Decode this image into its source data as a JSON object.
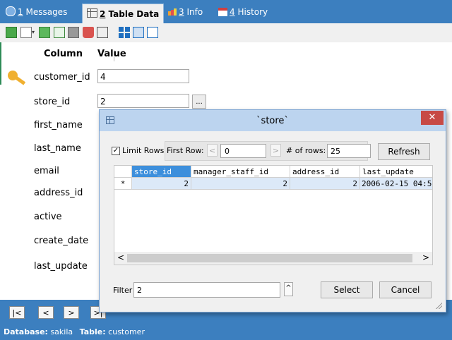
{
  "tabs": [
    {
      "num": "1",
      "label": "Messages"
    },
    {
      "num": "2",
      "label": "Table Data"
    },
    {
      "num": "3",
      "label": "Info"
    },
    {
      "num": "4",
      "label": "History"
    }
  ],
  "form": {
    "header_column": "Column",
    "header_value": "Value",
    "fields": [
      {
        "label": "customer_id",
        "value": "4"
      },
      {
        "label": "store_id",
        "value": "2"
      },
      {
        "label": "first_name"
      },
      {
        "label": "last_name"
      },
      {
        "label": "email"
      },
      {
        "label": "address_id"
      },
      {
        "label": "active"
      },
      {
        "label": "create_date"
      },
      {
        "label": "last_update"
      }
    ],
    "lookup_button": "..."
  },
  "nav": {
    "first": "|<",
    "prev": "<",
    "next": ">",
    "last": ">|"
  },
  "status": {
    "db_label": "Database:",
    "db_value": "sakila",
    "table_label": "Table:",
    "table_value": "customer"
  },
  "dialog": {
    "title": "`store`",
    "close": "✕",
    "limit_rows_label": "Limit Rows",
    "limit_checked": true,
    "first_row_label": "First Row:",
    "first_row_value": "0",
    "rows_label": "# of rows:",
    "rows_value": "25",
    "refresh": "Refresh",
    "grid": {
      "columns": [
        "store_id",
        "manager_staff_id",
        "address_id",
        "last_update"
      ],
      "rows": [
        {
          "marker": "*",
          "cells": [
            "2",
            "2",
            "2",
            "2006-02-15 04:5"
          ]
        }
      ]
    },
    "scroll_left": "<",
    "scroll_right": ">",
    "filter_label": "Filter",
    "filter_value": "2",
    "spin_up": "^",
    "select": "Select",
    "cancel": "Cancel"
  },
  "colors": {
    "accent": "#3c7fbf",
    "selected_header": "#3d8fdc",
    "selected_cell": "#dce9f8",
    "close_button": "#c74a45"
  }
}
